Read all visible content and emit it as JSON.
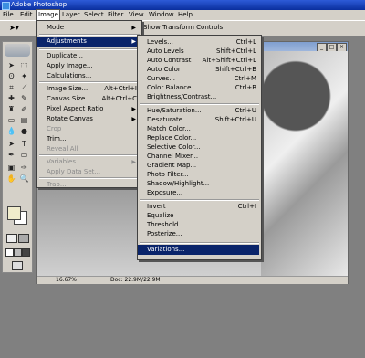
{
  "window": {
    "title": "Adobe Photoshop"
  },
  "menubar": [
    "File",
    "Edit",
    "Image",
    "Layer",
    "Select",
    "Filter",
    "View",
    "Window",
    "Help"
  ],
  "options": {
    "show_transform_label": "Show Transform Controls"
  },
  "status": {
    "zoom": "16.67%",
    "doc": "Doc: 22.9M/22.9M"
  },
  "image_menu": {
    "items": [
      {
        "label": "Mode",
        "arrow": "▶"
      },
      {
        "label": "Adjustments",
        "arrow": "▶"
      },
      {
        "label": "Duplicate..."
      },
      {
        "label": "Apply Image..."
      },
      {
        "label": "Calculations..."
      },
      {
        "label": "Image Size...",
        "shortcut": "Alt+Ctrl+I"
      },
      {
        "label": "Canvas Size...",
        "shortcut": "Alt+Ctrl+C"
      },
      {
        "label": "Pixel Aspect Ratio",
        "arrow": "▶"
      },
      {
        "label": "Rotate Canvas",
        "arrow": "▶"
      },
      {
        "label": "Crop"
      },
      {
        "label": "Trim..."
      },
      {
        "label": "Reveal All"
      },
      {
        "label": "Variables",
        "arrow": "▶"
      },
      {
        "label": "Apply Data Set..."
      },
      {
        "label": "Trap..."
      }
    ]
  },
  "adjust_menu": {
    "items": [
      {
        "label": "Levels...",
        "shortcut": "Ctrl+L"
      },
      {
        "label": "Auto Levels",
        "shortcut": "Shift+Ctrl+L"
      },
      {
        "label": "Auto Contrast",
        "shortcut": "Alt+Shift+Ctrl+L"
      },
      {
        "label": "Auto Color",
        "shortcut": "Shift+Ctrl+B"
      },
      {
        "label": "Curves...",
        "shortcut": "Ctrl+M"
      },
      {
        "label": "Color Balance...",
        "shortcut": "Ctrl+B"
      },
      {
        "label": "Brightness/Contrast..."
      },
      {
        "label": "Hue/Saturation...",
        "shortcut": "Ctrl+U"
      },
      {
        "label": "Desaturate",
        "shortcut": "Shift+Ctrl+U"
      },
      {
        "label": "Match Color..."
      },
      {
        "label": "Replace Color..."
      },
      {
        "label": "Selective Color..."
      },
      {
        "label": "Channel Mixer..."
      },
      {
        "label": "Gradient Map..."
      },
      {
        "label": "Photo Filter..."
      },
      {
        "label": "Shadow/Highlight..."
      },
      {
        "label": "Exposure..."
      },
      {
        "label": "Invert",
        "shortcut": "Ctrl+I"
      },
      {
        "label": "Equalize"
      },
      {
        "label": "Threshold..."
      },
      {
        "label": "Posterize..."
      },
      {
        "label": "Variations..."
      }
    ]
  },
  "icons": [
    "move-icon",
    "marquee-icon",
    "lasso-icon",
    "magic-wand-icon",
    "crop-icon",
    "slice-icon",
    "healing-icon",
    "brush-icon",
    "stamp-icon",
    "history-brush-icon",
    "eraser-icon",
    "gradient-icon",
    "blur-icon",
    "dodge-icon",
    "path-select-icon",
    "type-icon",
    "pen-icon",
    "shape-icon",
    "notes-icon",
    "eyedropper-icon",
    "hand-icon",
    "zoom-icon"
  ]
}
